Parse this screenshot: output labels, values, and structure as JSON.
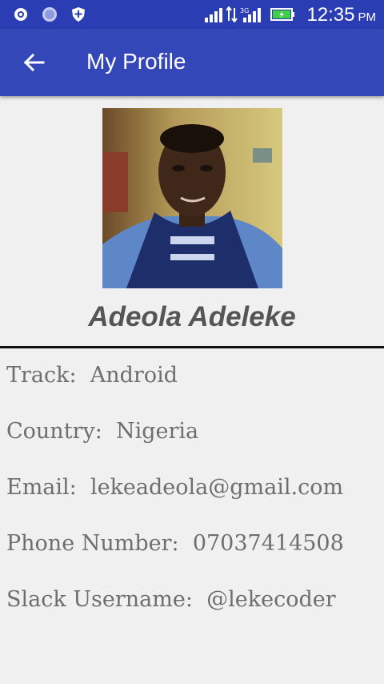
{
  "status_bar": {
    "time": "12:35",
    "ampm": "PM",
    "network": "3G",
    "icons": [
      "settings-icon",
      "circle-icon",
      "shield-plus-icon",
      "signal-icon",
      "data-arrows-icon",
      "signal-3g-icon",
      "battery-icon"
    ]
  },
  "app_bar": {
    "title": "My Profile",
    "back_icon": "arrow-back-icon"
  },
  "profile": {
    "name": "Adeola Adeleke",
    "fields": [
      {
        "label": "Track:",
        "value": "Android"
      },
      {
        "label": "Country:",
        "value": "Nigeria"
      },
      {
        "label": "Email:",
        "value": "lekeadeola@gmail.com"
      },
      {
        "label": "Phone Number:",
        "value": "07037414508"
      },
      {
        "label": "Slack Username:",
        "value": "@lekecoder"
      }
    ]
  },
  "colors": {
    "status_bar": "#2a3db3",
    "app_bar": "#3447b9",
    "background": "#f0f0f0",
    "field_text": "#6e6e6e",
    "name_text": "#555555"
  }
}
